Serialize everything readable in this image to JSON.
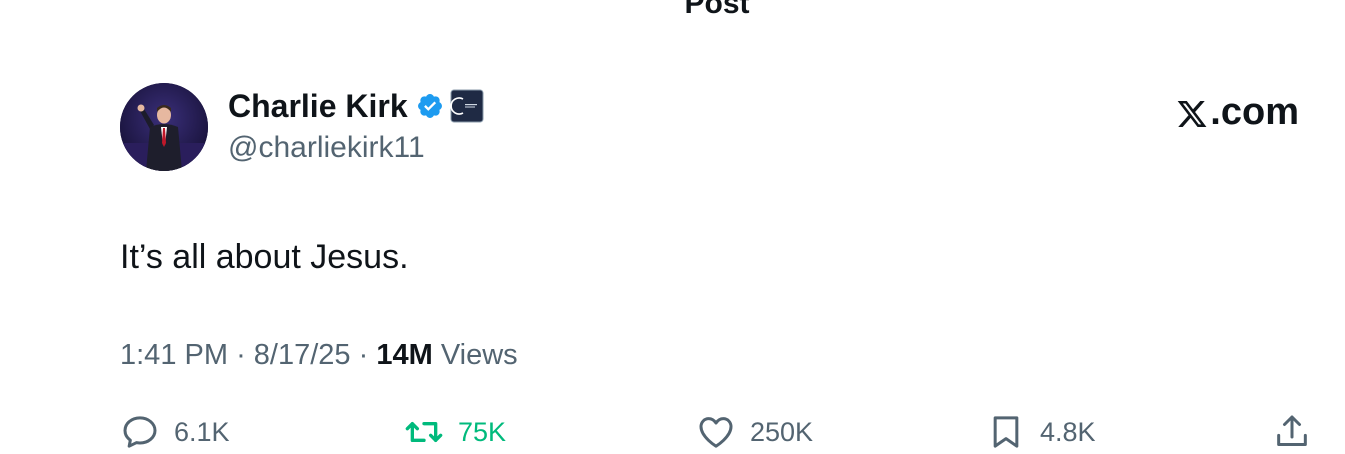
{
  "header": {
    "title": "Post"
  },
  "author": {
    "display_name": "Charlie Kirk",
    "handle": "@charliekirk11",
    "verified": true,
    "affiliate_badge": "organization-badge"
  },
  "brand": {
    "label": ".com",
    "logo": "x-logo"
  },
  "post": {
    "text": "It’s all about Jesus."
  },
  "meta": {
    "time": "1:41 PM",
    "separator": "·",
    "date": "8/17/25",
    "views_count": "14M",
    "views_label": "Views"
  },
  "actions": {
    "replies": "6.1K",
    "reposts": "75K",
    "likes": "250K",
    "bookmarks": "4.8K"
  },
  "colors": {
    "verified_blue": "#1d9bf0",
    "repost_green": "#00ba7c",
    "secondary_text": "#536471",
    "primary_text": "#0f1419"
  }
}
